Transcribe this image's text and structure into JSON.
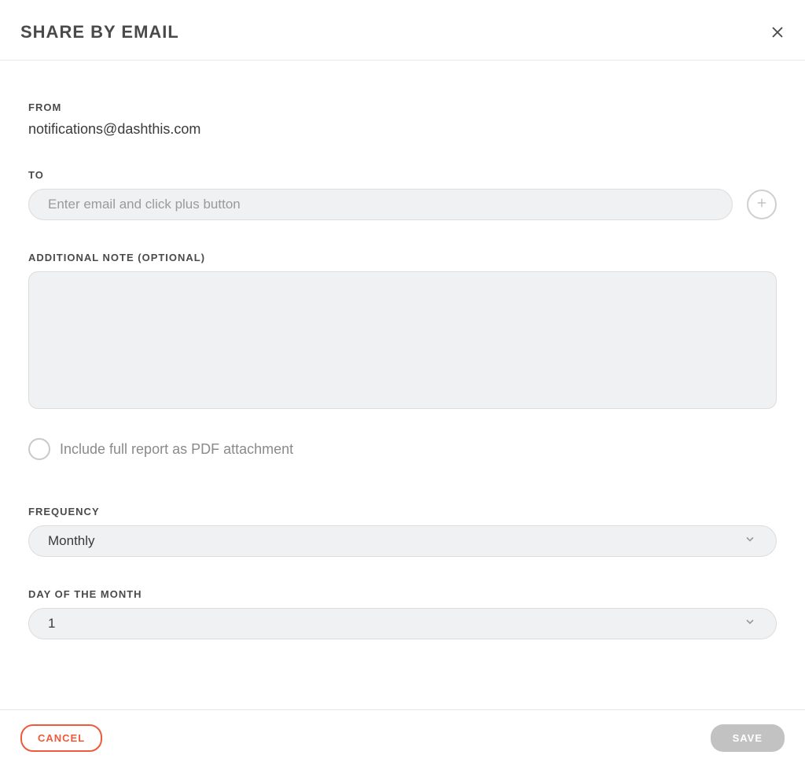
{
  "header": {
    "title": "SHARE BY EMAIL"
  },
  "form": {
    "from_label": "FROM",
    "from_value": "notifications@dashthis.com",
    "to_label": "TO",
    "to_placeholder": "Enter email and click plus button",
    "note_label": "ADDITIONAL NOTE (OPTIONAL)",
    "note_value": "",
    "include_pdf_label": "Include full report as PDF attachment",
    "frequency_label": "FREQUENCY",
    "frequency_value": "Monthly",
    "day_label": "DAY OF THE MONTH",
    "day_value": "1"
  },
  "footer": {
    "cancel_label": "CANCEL",
    "save_label": "SAVE"
  }
}
